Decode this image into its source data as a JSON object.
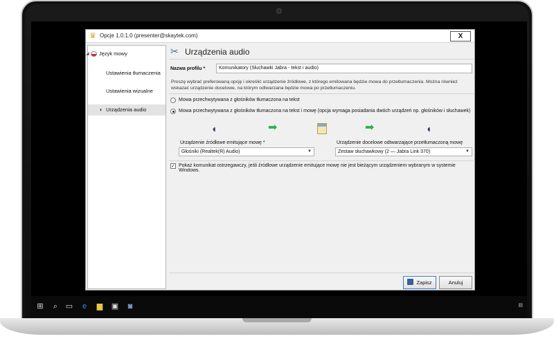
{
  "window": {
    "title": "Opcje 1.0.1.0 (presenter@skaytek.com)",
    "close_label": "X"
  },
  "sidebar": {
    "items": [
      {
        "label": "Język mowy"
      },
      {
        "label": "Ustawienia tłumaczenia"
      },
      {
        "label": "Ustawienia wizualne"
      },
      {
        "label": "Urządzenia audio"
      }
    ]
  },
  "main": {
    "title": "Urządzenia audio",
    "profile_label": "Nazwa profilu",
    "profile_required": "*",
    "profile_value": "Komunikatory (Słuchawki Jabra - tekst i audio)",
    "description": "Proszę wybrać preferowaną opcję i określić urządzenie źródłowe, z którego emitowana będzie mowa do przetłumaczenia. Można również wskazać urządzenie docelowe, na którym odtwarzana będzie mowa po przetłumaczeniu.",
    "option1": "Mowa przechwytywana z głośników tłumaczona na tekst",
    "option2": "Mowa przechwytywana z głośników tłumaczona na tekst i mowę (opcja wymaga posiadania dwóch urządzeń np. głośników i słuchawek)",
    "source_label": "Urządzenie źródłowe emitujące mowę *",
    "source_value": "Głośniki (Realtek(R) Audio)",
    "target_label": "Urządzenie docelowe odtwarzające przetłumaczoną mowę",
    "target_value": "Zestaw słuchawkowy (2 — Jabra Link 370)",
    "warning_label": "Pokaż komunikat ostrzegawczy, jeśli źródłowe urządzenie emitujące mowę nie jest bieżącym urządzeniem wybranym w systemie Windows.",
    "save_label": "Zapisz",
    "cancel_label": "Anuluj"
  },
  "icons": [
    "app-icon",
    "flag-icon",
    "speaker-icon",
    "tools-icon",
    "arrow-right-icon",
    "document-icon",
    "windows-icon",
    "search-icon",
    "task-view-icon",
    "edge-icon",
    "explorer-icon",
    "store-icon"
  ]
}
